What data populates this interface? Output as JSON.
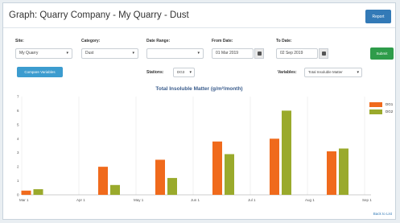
{
  "window": {
    "title": "Graph: Quarry Company - My Quarry - Dust",
    "report_label": "Report"
  },
  "filters": {
    "site_label": "Site:",
    "site_value": "My Quarry",
    "category_label": "Category:",
    "category_value": "Dust",
    "date_range_label": "Date Range:",
    "date_range_value": "",
    "from_label": "From Date:",
    "from_value": "01 Mar 2019",
    "to_label": "To Date:",
    "to_value": "02 Sep 2019",
    "submit_label": "Submit",
    "compare_label": "Compare Variables",
    "stations_label": "Stations:",
    "stations_value": "DG3",
    "variables_label": "Variables:",
    "variables_value": "Total Insoluble Matter"
  },
  "chart_data": {
    "type": "bar",
    "title": "Total Insoluble Matter (g/m²/month)",
    "x": [
      "Mar 1",
      "Apr 1",
      "May 1",
      "Jun 1",
      "Jul 1",
      "Aug 1",
      "Sep 1"
    ],
    "ylim": [
      0,
      7
    ],
    "yticks": [
      0,
      1,
      2,
      3,
      4,
      5,
      6,
      7
    ],
    "grid": "vertical",
    "legend_position": "right",
    "series": [
      {
        "name": "DG1",
        "color": "#f06a1c",
        "values": [
          0.3,
          2.0,
          2.5,
          3.8,
          4.0,
          3.1,
          null
        ]
      },
      {
        "name": "DG2",
        "color": "#9aaa2c",
        "values": [
          0.4,
          0.7,
          1.2,
          2.9,
          6.0,
          3.3,
          null
        ]
      }
    ]
  },
  "footer": {
    "back_label": "Back to List"
  }
}
